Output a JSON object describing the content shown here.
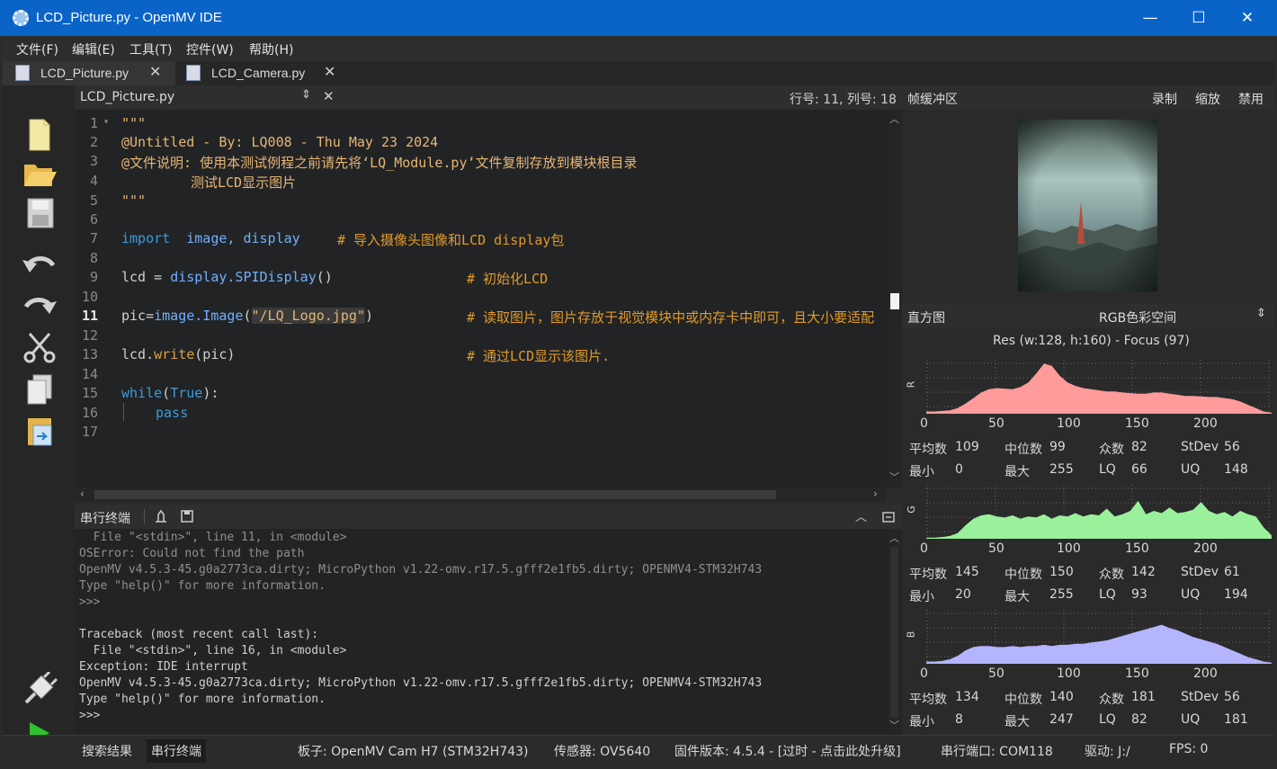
{
  "window": {
    "title": "LCD_Picture.py - OpenMV IDE",
    "minimize": "—",
    "maximize": "☐",
    "close": "✕"
  },
  "menu": [
    "文件(F)",
    "编辑(E)",
    "工具(T)",
    "控件(W)",
    "帮助(H)"
  ],
  "file_tabs": [
    {
      "label": "LCD_Picture.py"
    },
    {
      "label": "LCD_Camera.py"
    }
  ],
  "editor": {
    "filename": "LCD_Picture.py",
    "cursor_pos": "行号: 11, 列号: 18",
    "line_numbers": [
      "1",
      "2",
      "3",
      "4",
      "5",
      "6",
      "7",
      "8",
      "9",
      "10",
      "11",
      "12",
      "13",
      "14",
      "15",
      "16",
      "17"
    ]
  },
  "code": {
    "l1": "\"\"\"",
    "l2": "@Untitled - By: LQ008 - Thu May 23 2024",
    "l3": "@文件说明: 使用本测试例程之前请先将‘LQ_Module.py’文件复制存放到模块根目录",
    "l4": "测试LCD显示图片",
    "l5": "\"\"\"",
    "l7_kw": "import",
    "l7_mods": "image, display",
    "l7_cm": "# 导入摄像头图像和LCD display包",
    "l9_a": "lcd = ",
    "l9_b": "display.SPIDisplay",
    "l9_c": "()",
    "l9_cm": "# 初始化LCD",
    "l11_a": "pic=",
    "l11_b": "image.Image",
    "l11_c": "(",
    "l11_str": "\"/LQ_Logo.jpg\"",
    "l11_d": ")",
    "l11_cm": "# 读取图片，图片存放于视觉模块中或内存卡中即可，且大小要适配",
    "l13_a": "lcd.",
    "l13_b": "write",
    "l13_c": "(pic)",
    "l13_cm": "# 通过LCD显示该图片.",
    "l15_a": "while",
    "l15_b": "(",
    "l15_c": "True",
    "l15_d": "):",
    "l16": "pass"
  },
  "terminal": {
    "title": "串行终端",
    "lines": [
      "  File \"<stdin>\", line 11, in <module>",
      "OSError: Could not find the path",
      "OpenMV v4.5.3-45.g0a2773ca.dirty; MicroPython v1.22-omv.r17.5.gfff2e1fb5.dirty; OPENMV4-STM32H743",
      "Type \"help()\" for more information.",
      ">>>",
      "",
      "Traceback (most recent call last):",
      "  File \"<stdin>\", line 16, in <module>",
      "Exception: IDE interrupt",
      "OpenMV v4.5.3-45.g0a2773ca.dirty; MicroPython v1.22-omv.r17.5.gfff2e1fb5.dirty; OPENMV4-STM32H743",
      "Type \"help()\" for more information.",
      ">>>"
    ]
  },
  "framebuffer": {
    "title": "帧缓冲区",
    "record": "录制",
    "zoom": "缩放",
    "disable": "禁用"
  },
  "histogram": {
    "title": "直方图",
    "colorspace": "RGB色彩空间",
    "res": "Res (w:128, h:160) - Focus (97)",
    "axis": [
      "0",
      "50",
      "100",
      "150",
      "200"
    ],
    "channels": [
      {
        "label": "R",
        "color": "#ff9b9b",
        "mean": "109",
        "median": "99",
        "mode": "82",
        "stdev": "56",
        "min": "0",
        "max": "255",
        "lq": "66",
        "uq": "148"
      },
      {
        "label": "G",
        "color": "#9bf09b",
        "mean": "145",
        "median": "150",
        "mode": "142",
        "stdev": "61",
        "min": "20",
        "max": "255",
        "lq": "93",
        "uq": "194"
      },
      {
        "label": "B",
        "color": "#b4b4ff",
        "mean": "134",
        "median": "140",
        "mode": "181",
        "stdev": "56",
        "min": "8",
        "max": "247",
        "lq": "82",
        "uq": "181"
      }
    ],
    "labels": {
      "mean": "平均数",
      "median": "中位数",
      "mode": "众数",
      "stdev": "StDev",
      "min": "最小",
      "max": "最大",
      "lq": "LQ",
      "uq": "UQ"
    }
  },
  "status": {
    "search": "搜索结果",
    "serial": "串行终端",
    "board": "板子: OpenMV Cam H7 (STM32H743)",
    "sensor": "传感器: OV5640",
    "firmware": "固件版本: 4.5.4 - [过时 - 点击此处升级]",
    "port": "串行端口: COM118",
    "drive": "驱动: J:/",
    "fps": "FPS: 0"
  }
}
